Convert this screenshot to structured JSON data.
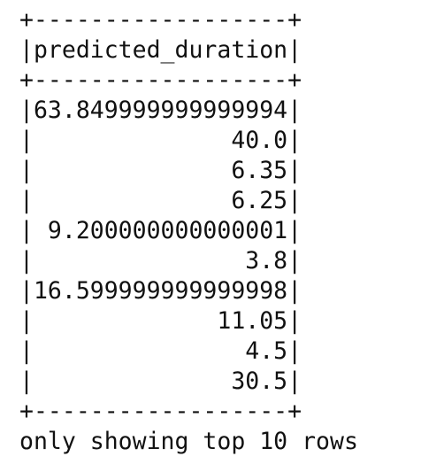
{
  "table": {
    "border_top": "+------------------+",
    "header": "|predicted_duration|",
    "border_mid": "+------------------+",
    "rows": [
      "|63.849999999999994|",
      "|              40.0|",
      "|              6.35|",
      "|              6.25|",
      "| 9.200000000000001|",
      "|               3.8|",
      "|16.599999999999998|",
      "|             11.05|",
      "|               4.5|",
      "|              30.5|"
    ],
    "border_bottom": "+------------------+"
  },
  "footer": "only showing top 10 rows"
}
